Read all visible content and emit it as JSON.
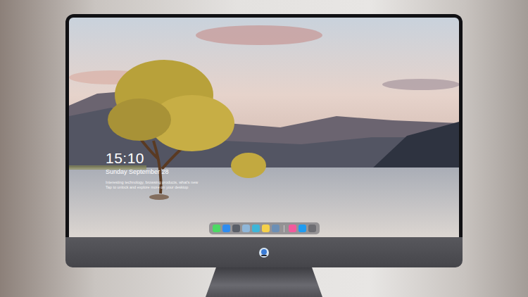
{
  "screen": {
    "clock": "15:10",
    "date": "Sunday September 28",
    "caption": [
      "Interesting technology, browsing products, what's new",
      "Tap to unlock and explore more on your desktop"
    ]
  },
  "dock": {
    "items": [
      {
        "kind": "app",
        "color": "#4cd964"
      },
      {
        "kind": "app",
        "color": "#2f8cf0"
      },
      {
        "kind": "app",
        "color": "#5a5f68"
      },
      {
        "kind": "app",
        "color": "#8fb7d9"
      },
      {
        "kind": "app",
        "color": "#3fb6d8"
      },
      {
        "kind": "app",
        "color": "#f5d04a"
      },
      {
        "kind": "app",
        "color": "#6c8fb5"
      },
      {
        "kind": "separator"
      },
      {
        "kind": "app",
        "color": "#f25a9c"
      },
      {
        "kind": "app",
        "color": "#1f9bf0"
      },
      {
        "kind": "app",
        "color": "#6e6e73"
      }
    ]
  }
}
